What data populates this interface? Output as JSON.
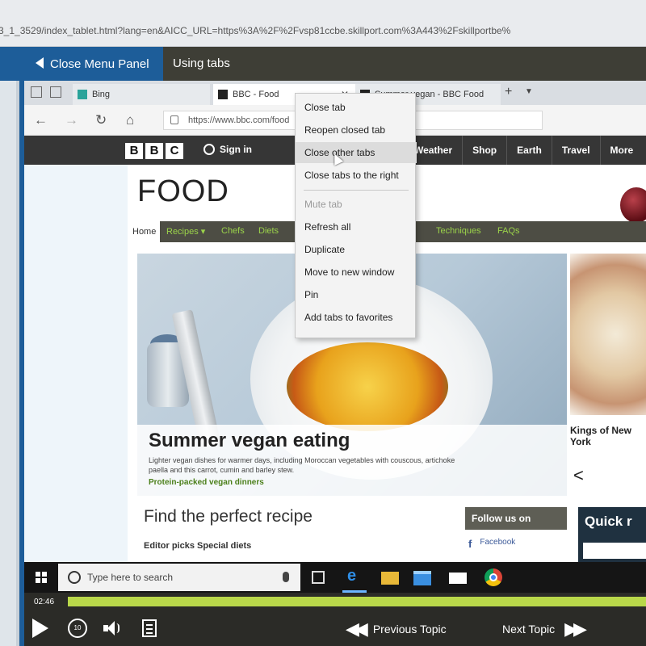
{
  "url_bar": {
    "text": "3_1_3529/index_tablet.html?lang=en&AICC_URL=https%3A%2F%2Fvsp81ccbe.skillport.com%3A443%2Fskillportbe%"
  },
  "player": {
    "close_panel": "Close Menu Panel",
    "topic_title": "Using tabs",
    "time": "02:46",
    "progress_fraction": 1.0,
    "replay_label": "10",
    "prev_topic": "Previous Topic",
    "next_topic": "Next Topic",
    "accent_color": "#1d5d99",
    "progress_color": "#9bc33a"
  },
  "browser": {
    "tabs": [
      {
        "label": "Bing",
        "icon": "bing-icon"
      },
      {
        "label": "BBC - Food",
        "icon": "bbc-icon"
      },
      {
        "label": "Summer vegan - BBC Food",
        "icon": "bbc-icon"
      }
    ],
    "address": "https://www.bbc.com/food"
  },
  "bbc": {
    "logo": [
      "B",
      "B",
      "C"
    ],
    "signin": "Sign in",
    "nav": [
      "Weather",
      "Shop",
      "Earth",
      "Travel",
      "More"
    ]
  },
  "food_page": {
    "title": "FOOD",
    "nav": {
      "home": "Home",
      "items": [
        "Recipes ▾",
        "Chefs",
        "Diets",
        "Techniques",
        "FAQs"
      ]
    },
    "hero": {
      "title": "Summer vegan eating",
      "subtitle": "Lighter vegan dishes for warmer days, including Moroccan vegetables with couscous, artichoke paella and this carrot, cumin and barley stew.",
      "link": "Protein-packed vegan dinners"
    },
    "side": {
      "title": "Kings of New York",
      "arrow": "<"
    },
    "find_title": "Find the perfect recipe",
    "editor_picks": "Editor picks    Special diets",
    "follow_us": "Follow us on",
    "facebook": "Facebook",
    "quick": "Quick r"
  },
  "context_menu": {
    "items": [
      {
        "label": "Close tab",
        "state": "normal"
      },
      {
        "label": "Reopen closed tab",
        "state": "normal"
      },
      {
        "label": "Close other tabs",
        "state": "hover"
      },
      {
        "label": "Close tabs to the right",
        "state": "normal"
      },
      {
        "label": "Mute tab",
        "state": "disabled"
      },
      {
        "label": "Refresh all",
        "state": "normal"
      },
      {
        "label": "Duplicate",
        "state": "normal"
      },
      {
        "label": "Move to new window",
        "state": "normal"
      },
      {
        "label": "Pin",
        "state": "normal"
      },
      {
        "label": "Add tabs to favorites",
        "state": "normal"
      }
    ]
  },
  "taskbar": {
    "search_placeholder": "Type here to search",
    "icons": [
      "windows-start-icon",
      "task-view-icon",
      "edge-icon",
      "file-explorer-icon",
      "store-icon",
      "mail-icon",
      "chrome-icon"
    ]
  }
}
